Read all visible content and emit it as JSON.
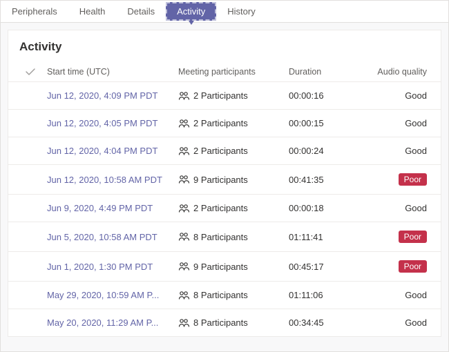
{
  "tabs": {
    "items": [
      {
        "label": "Peripherals",
        "active": false
      },
      {
        "label": "Health",
        "active": false
      },
      {
        "label": "Details",
        "active": false
      },
      {
        "label": "Activity",
        "active": true
      },
      {
        "label": "History",
        "active": false
      }
    ]
  },
  "panel": {
    "title": "Activity"
  },
  "columns": {
    "start": "Start time (UTC)",
    "participants": "Meeting participants",
    "duration": "Duration",
    "audio": "Audio quality"
  },
  "quality_labels": {
    "good": "Good",
    "poor": "Poor"
  },
  "rows": [
    {
      "start": "Jun 12, 2020, 4:09 PM PDT",
      "participants": "2 Participants",
      "duration": "00:00:16",
      "audio": "good"
    },
    {
      "start": "Jun 12, 2020, 4:05 PM PDT",
      "participants": "2 Participants",
      "duration": "00:00:15",
      "audio": "good"
    },
    {
      "start": "Jun 12, 2020, 4:04 PM PDT",
      "participants": "2 Participants",
      "duration": "00:00:24",
      "audio": "good"
    },
    {
      "start": "Jun 12, 2020, 10:58 AM PDT",
      "participants": "9 Participants",
      "duration": "00:41:35",
      "audio": "poor"
    },
    {
      "start": "Jun 9, 2020, 4:49 PM PDT",
      "participants": "2 Participants",
      "duration": "00:00:18",
      "audio": "good"
    },
    {
      "start": "Jun 5, 2020, 10:58 AM PDT",
      "participants": "8 Participants",
      "duration": "01:11:41",
      "audio": "poor"
    },
    {
      "start": "Jun 1, 2020, 1:30 PM PDT",
      "participants": "9 Participants",
      "duration": "00:45:17",
      "audio": "poor"
    },
    {
      "start": "May 29, 2020, 10:59 AM P...",
      "participants": "8 Participants",
      "duration": "01:11:06",
      "audio": "good"
    },
    {
      "start": "May 20, 2020, 11:29 AM P...",
      "participants": "8 Participants",
      "duration": "00:34:45",
      "audio": "good"
    }
  ]
}
